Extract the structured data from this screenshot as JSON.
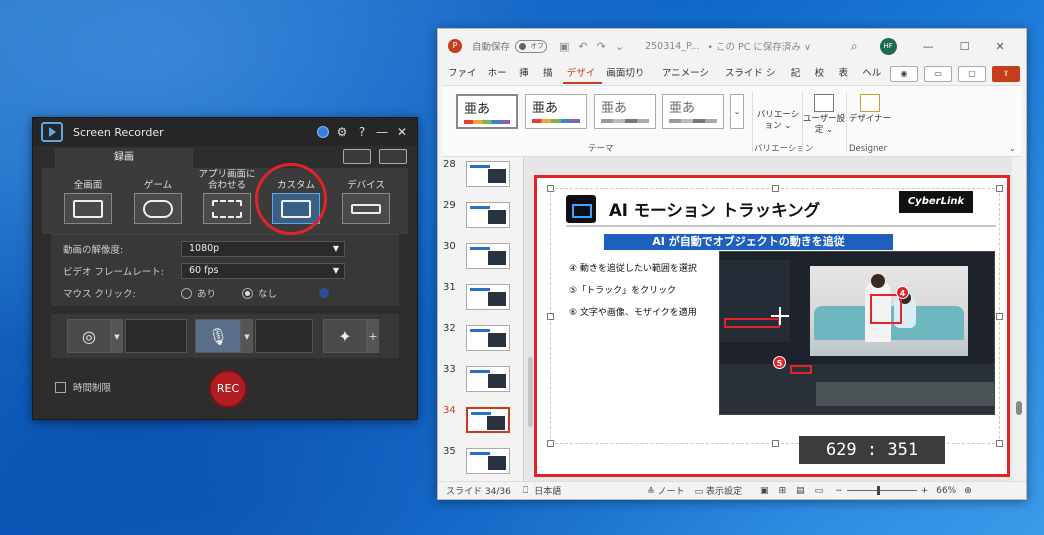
{
  "screen_recorder": {
    "title": "Screen Recorder",
    "controls": {
      "settings": "⚙",
      "help": "?",
      "minimize": "—",
      "close": "✕"
    },
    "tab": "録画",
    "modes": [
      {
        "label": "全画面",
        "icon": "fullscreen-icon"
      },
      {
        "label": "ゲーム",
        "icon": "gamepad-icon"
      },
      {
        "label": "アプリ画面に合わせる",
        "icon": "app-window-icon"
      },
      {
        "label": "カスタム",
        "icon": "custom-area-icon",
        "active": true
      },
      {
        "label": "デバイス",
        "icon": "device-icon"
      }
    ],
    "settings": {
      "resolution_label": "動画の解像度:",
      "resolution_value": "1080p",
      "framerate_label": "ビデオ フレームレート:",
      "framerate_value": "60 fps",
      "mouse_label": "マウス クリック:",
      "mouse_on": "あり",
      "mouse_off": "なし",
      "mouse_selected": "なし"
    },
    "time_limit": "時間制限",
    "rec": "REC"
  },
  "powerpoint": {
    "autosave_label": "自動保存",
    "autosave_toggle": "オフ",
    "filename": "250314_P...",
    "save_status": "• この PC に保存済み ∨",
    "avatar": "HF",
    "menus": [
      "ファイル",
      "ホーム",
      "挿入",
      "描画",
      "デザイン",
      "画面切り替え",
      "アニメーション",
      "スライド ショー",
      "記録",
      "校閲",
      "表示",
      "ヘルプ"
    ],
    "active_menu": "デザイン",
    "themes": [
      "亜あ",
      "亜あ",
      "亜あ",
      "亜あ"
    ],
    "ribbon": {
      "theme_group": "テーマ",
      "variation_button": "バリエーション",
      "variation_group": "バリエーション",
      "user_settings_button": "ユーザー設定",
      "designer_button": "デザイナー",
      "designer_group": "Designer"
    },
    "thumbnails": [
      {
        "num": "28"
      },
      {
        "num": "29"
      },
      {
        "num": "30"
      },
      {
        "num": "31"
      },
      {
        "num": "32"
      },
      {
        "num": "33"
      },
      {
        "num": "34",
        "selected": true
      },
      {
        "num": "35"
      }
    ],
    "slide": {
      "title": "AI モーション トラッキング",
      "brand": "CyberLink",
      "subtitle": "AI が自動でオブジェクトの動きを追従",
      "steps": [
        "④ 動きを追従したい範囲を選択",
        "⑤「トラック」をクリック",
        "⑥ 文字や画像、モザイクを適用"
      ],
      "badge4": "4",
      "badge5": "5"
    },
    "coordinates": "629 : 351",
    "status": {
      "slide": "スライド 34/36",
      "language": "日本語",
      "notes": "ノート",
      "display_settings": "表示設定",
      "zoom": "66%"
    }
  }
}
